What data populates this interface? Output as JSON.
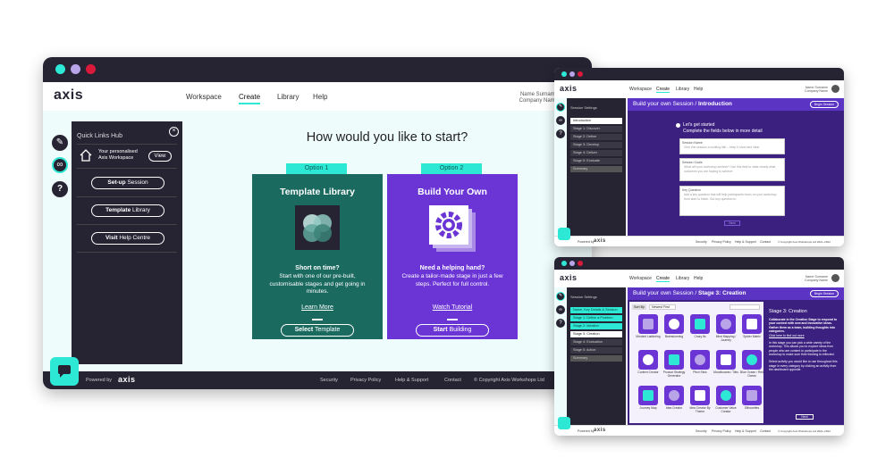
{
  "colors": {
    "dark": "#262433",
    "teal": "#2ee8d6",
    "green_card": "#1a6a60",
    "purple_card": "#6b35d6",
    "mint_bg": "#eefcfb"
  },
  "main": {
    "logo": "axis",
    "nav": [
      "Workspace",
      "Create",
      "Library",
      "Help"
    ],
    "active_nav": "Create",
    "user_name": "Name Surname",
    "user_company": "Company Name",
    "heading": "How would you like to start?",
    "quick_links": {
      "title": "Quick Links Hub",
      "workspace_line1": "Your personalised",
      "workspace_line2": "Axis Workspace",
      "view_label": "View",
      "buttons": [
        {
          "bold": "Set-up",
          "rest": " Session"
        },
        {
          "bold": "Template",
          "rest": " Library"
        },
        {
          "bold": "Visit",
          "rest": " Help Centre"
        }
      ]
    },
    "side_icons": [
      "pencil-icon",
      "link-icon",
      "help-icon"
    ],
    "options": [
      {
        "tab": "Option 1",
        "title": "Template Library",
        "head": "Short on time?",
        "desc": "Start with one of our pre-built, customisable stages and get going in minutes.",
        "link": "Learn More",
        "button_bold": "Select",
        "button_rest": " Template"
      },
      {
        "tab": "Option 2",
        "title": "Build Your Own",
        "head": "Need a helping hand?",
        "desc": "Create a tailor-made stage in just a few steps. Perfect for full control.",
        "link": "Watch Tutorial",
        "button_bold": "Start",
        "button_rest": " Building"
      }
    ],
    "footer": {
      "powered_by": "Powered by",
      "logo": "axis",
      "links": [
        "Security",
        "Privacy Policy",
        "Help & Support",
        "Contact",
        "© Copyright Axis Workshops Ltd"
      ]
    }
  },
  "intro_window": {
    "logo": "axis",
    "nav": [
      "Workspace",
      "Create",
      "Library",
      "Help"
    ],
    "user_name": "Name Surname",
    "user_company": "Company Name",
    "sidebar_title": "Session Settings",
    "sidebar_items": [
      "Introduction",
      "Stage 1: Discover",
      "Stage 2: Define",
      "Stage 3: Develop",
      "Stage 4: Deliver",
      "Stage 5: Evaluate",
      "Summary"
    ],
    "header_prefix": "Build your own Session / ",
    "header_bold": "Introduction",
    "header_button": "Begin Session",
    "intro_line1": "Let's get started",
    "intro_line2": "Complete the fields below in more detail",
    "fields": [
      {
        "label": "Session Name",
        "value": "Give this session a working title – keep it short and clear"
      },
      {
        "label": "Session Goals",
        "value": "What will your workshop achieve? Use this field to state clearly what outcomes you are hoping to achieve"
      },
      {
        "label": "Key Question",
        "value": "Add a key question that will help participants focus on your workshop from start to finish. Our key question is:"
      }
    ],
    "next_label": "Next",
    "footer_powered": "Powered by",
    "footer_logo": "axis",
    "footer_links": [
      "Security",
      "Privacy Policy",
      "Help & Support",
      "Contact",
      "© Copyright Axis Workshops Ltd 2021–2022"
    ]
  },
  "creation_window": {
    "logo": "axis",
    "nav": [
      "Workspace",
      "Create",
      "Library",
      "Help"
    ],
    "user_name": "Name Surname",
    "user_company": "Company Name",
    "sidebar_title": "Session Settings",
    "sidebar_items": [
      "Name, Key Details & Session",
      "Stage 1: Define a Problem",
      "Stage 2: Ideation",
      "Stage 3: Creation",
      "Stage 4: Evaluation",
      "Stage 5: Action",
      "Summary"
    ],
    "header_prefix": "Build your own Session / ",
    "header_bold": "Stage 3: Creation",
    "header_button": "Begin Session",
    "filter_label": "Sort By",
    "filter_value": "Newest First",
    "tiles": [
      [
        "Mindset Laddering",
        "Brainstorming",
        "Crazy 8s",
        "Mind Mapping / Journey",
        "Spider Matrix"
      ],
      [
        "Context Creator",
        "Product Strategy Generator",
        "Pitch Stick",
        "Moodboards / Tiles",
        "Blue Ocean / Red Ocean"
      ],
      [
        "Journey Map",
        "Idea Creator",
        "Idea Creator By Theme",
        "Customer Value Creator",
        "Silhouettes"
      ]
    ],
    "panel_title": "Stage 3: Creation",
    "panel_text1": "Collaborate in the Creation Stage to respond to your context with new and innovative ideas. Gather them as a team, building thoughts into categories.",
    "panel_link": "Click here to find out more",
    "panel_text2": "In this stage you can pick a wide variety of the workshop. This allows you to explore ideas from people who are content to participate in the workshop to make sure their thinking is reflected.",
    "panel_text3": "Select activity you would like to use throughout this stage in every category by clicking an activity from the dashboard opposite.",
    "panel_button": "Next",
    "footer_powered": "Powered by",
    "footer_logo": "axis",
    "footer_links": [
      "Security",
      "Privacy Policy",
      "Help & Support",
      "Contact",
      "© Copyright Axis Workshops Ltd 2021–2022"
    ]
  }
}
